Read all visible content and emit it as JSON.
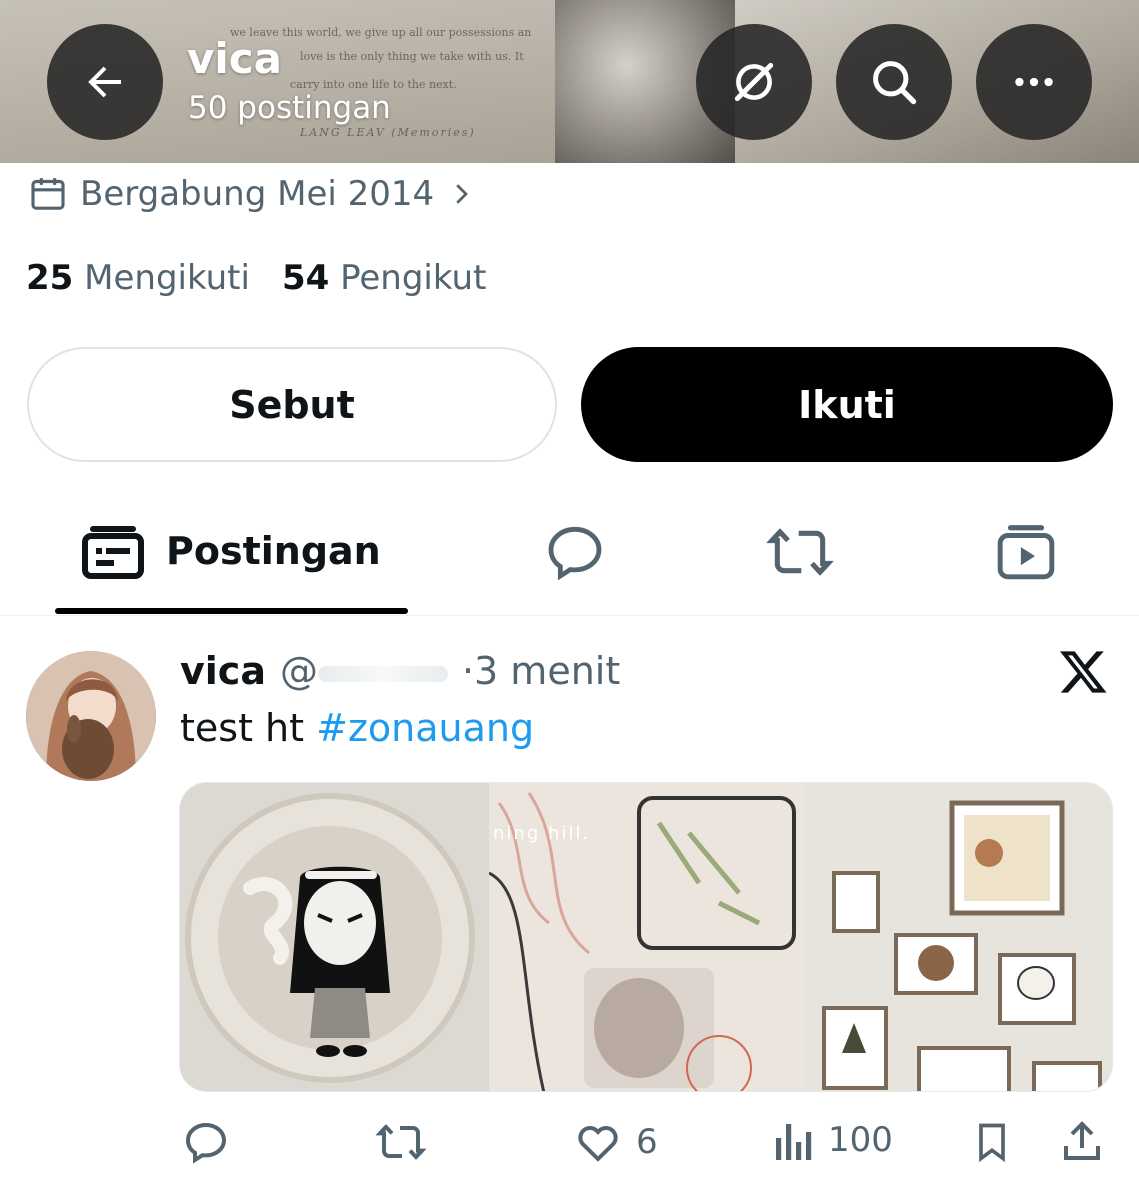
{
  "header": {
    "title": "vica",
    "subtitle": "50 postingan",
    "banner_text_lines": [
      "we leave this world, we give up all our possessions an",
      "love is the only thing we take with us. It",
      "carry into one life to the next.",
      "LANG LEAV (Memories)"
    ],
    "buttons": {
      "back_icon": "arrow-left-icon",
      "grok_icon": "grok-icon",
      "search_icon": "search-icon",
      "more_icon": "more-horizontal-icon"
    }
  },
  "profile": {
    "joined": "Bergabung Mei 2014",
    "following_count": "25",
    "following_label": "Mengikuti",
    "followers_count": "54",
    "followers_label": "Pengikut",
    "mention_button": "Sebut",
    "follow_button": "Ikuti"
  },
  "tabs": {
    "active_label": "Postingan",
    "icons": [
      "posts-icon",
      "reply-icon",
      "repost-icon",
      "media-icon"
    ]
  },
  "post": {
    "author_name": "vica",
    "author_handle": "@",
    "time": "·3 menit",
    "text_prefix": "test ht ",
    "hashtag": "#zonauang",
    "image_caption": "ning hill.",
    "stats": {
      "likes": "6",
      "views": "100"
    }
  },
  "colors": {
    "link": "#1d9bf0",
    "muted": "#536471",
    "text": "#0f1419"
  }
}
